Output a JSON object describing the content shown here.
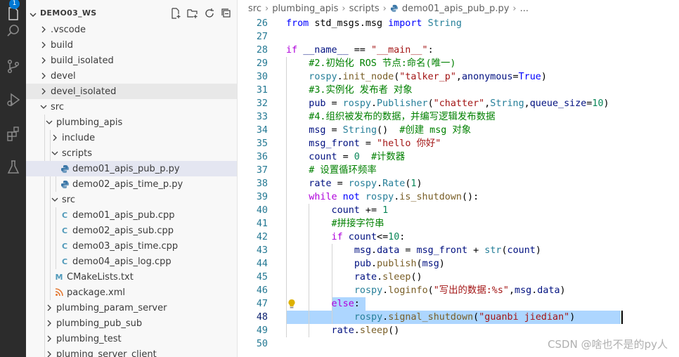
{
  "activity_bar": {
    "badge_count": "1",
    "icons": [
      "explorer-icon",
      "search-icon",
      "source-control-icon",
      "run-debug-icon",
      "extensions-icon",
      "testing-icon"
    ]
  },
  "sidebar": {
    "workspace_title": "DEMO03_WS",
    "tree": [
      {
        "label": ".vscode",
        "kind": "folder",
        "open": false,
        "depth": 0
      },
      {
        "label": "build",
        "kind": "folder",
        "open": false,
        "depth": 0
      },
      {
        "label": "build_isolated",
        "kind": "folder",
        "open": false,
        "depth": 0
      },
      {
        "label": "devel",
        "kind": "folder",
        "open": false,
        "depth": 0
      },
      {
        "label": "devel_isolated",
        "kind": "folder",
        "open": false,
        "depth": 0,
        "state": "hover"
      },
      {
        "label": "src",
        "kind": "folder",
        "open": true,
        "depth": 0
      },
      {
        "label": "plumbing_apis",
        "kind": "folder",
        "open": true,
        "depth": 1
      },
      {
        "label": "include",
        "kind": "folder",
        "open": false,
        "depth": 2
      },
      {
        "label": "scripts",
        "kind": "folder",
        "open": true,
        "depth": 2
      },
      {
        "label": "demo01_apis_pub_p.py",
        "kind": "python",
        "depth": 3,
        "state": "selected"
      },
      {
        "label": "demo02_apis_time_p.py",
        "kind": "python",
        "depth": 3
      },
      {
        "label": "src",
        "kind": "folder",
        "open": true,
        "depth": 2
      },
      {
        "label": "demo01_apis_pub.cpp",
        "kind": "cpp",
        "depth": 3
      },
      {
        "label": "demo02_apis_sub.cpp",
        "kind": "cpp",
        "depth": 3
      },
      {
        "label": "demo03_apis_time.cpp",
        "kind": "cpp",
        "depth": 3
      },
      {
        "label": "demo04_apis_log.cpp",
        "kind": "cpp",
        "depth": 3
      },
      {
        "label": "CMakeLists.txt",
        "kind": "cmake",
        "depth": 2
      },
      {
        "label": "package.xml",
        "kind": "xml",
        "depth": 2
      },
      {
        "label": "plumbing_param_server",
        "kind": "folder",
        "open": false,
        "depth": 1
      },
      {
        "label": "plumbing_pub_sub",
        "kind": "folder",
        "open": false,
        "depth": 1
      },
      {
        "label": "plumbing_test",
        "kind": "folder",
        "open": false,
        "depth": 1
      },
      {
        "label": "pluming_server_client",
        "kind": "folder",
        "open": false,
        "depth": 1
      }
    ]
  },
  "breadcrumb": [
    "src",
    "plumbing_apis",
    "scripts",
    "demo01_apis_pub_p.py",
    "..."
  ],
  "editor": {
    "active_line": 48,
    "lines": [
      {
        "n": "26",
        "indent": 0,
        "tokens": [
          [
            "kw",
            "from "
          ],
          [
            "plain",
            "std_msgs.msg "
          ],
          [
            "kw",
            "import "
          ],
          [
            "cls",
            "String"
          ]
        ]
      },
      {
        "n": "27",
        "indent": 0,
        "tokens": []
      },
      {
        "n": "28",
        "indent": 0,
        "tokens": [
          [
            "ctl",
            "if "
          ],
          [
            "var",
            "__name__"
          ],
          [
            "plain",
            " == "
          ],
          [
            "str",
            "\"__main__\""
          ],
          [
            "plain",
            ":"
          ]
        ]
      },
      {
        "n": "29",
        "indent": 1,
        "tokens": [
          [
            "cmt",
            "#2.初始化 ROS 节点:命名(唯一)"
          ]
        ]
      },
      {
        "n": "30",
        "indent": 1,
        "tokens": [
          [
            "cls",
            "rospy"
          ],
          [
            "plain",
            "."
          ],
          [
            "fn",
            "init_node"
          ],
          [
            "plain",
            "("
          ],
          [
            "str",
            "\"talker_p\""
          ],
          [
            "plain",
            ","
          ],
          [
            "var",
            "anonymous"
          ],
          [
            "plain",
            "="
          ],
          [
            "kw",
            "True"
          ],
          [
            "plain",
            ")"
          ]
        ]
      },
      {
        "n": "31",
        "indent": 1,
        "tokens": [
          [
            "cmt",
            "#3.实例化 发布者 对象"
          ]
        ]
      },
      {
        "n": "32",
        "indent": 1,
        "tokens": [
          [
            "var",
            "pub"
          ],
          [
            "plain",
            " = "
          ],
          [
            "cls",
            "rospy"
          ],
          [
            "plain",
            "."
          ],
          [
            "cls",
            "Publisher"
          ],
          [
            "plain",
            "("
          ],
          [
            "str",
            "\"chatter\""
          ],
          [
            "plain",
            ","
          ],
          [
            "cls",
            "String"
          ],
          [
            "plain",
            ","
          ],
          [
            "var",
            "queue_size"
          ],
          [
            "plain",
            "="
          ],
          [
            "num",
            "10"
          ],
          [
            "plain",
            ")"
          ]
        ]
      },
      {
        "n": "33",
        "indent": 1,
        "tokens": [
          [
            "cmt",
            "#4.组织被发布的数据，并编写逻辑发布数据"
          ]
        ]
      },
      {
        "n": "34",
        "indent": 1,
        "tokens": [
          [
            "var",
            "msg"
          ],
          [
            "plain",
            " = "
          ],
          [
            "cls",
            "String"
          ],
          [
            "plain",
            "()  "
          ],
          [
            "cmt",
            "#创建 msg 对象"
          ]
        ]
      },
      {
        "n": "35",
        "indent": 1,
        "tokens": [
          [
            "var",
            "msg_front"
          ],
          [
            "plain",
            " = "
          ],
          [
            "str",
            "\"hello 你好\""
          ]
        ]
      },
      {
        "n": "36",
        "indent": 1,
        "tokens": [
          [
            "var",
            "count"
          ],
          [
            "plain",
            " = "
          ],
          [
            "num",
            "0"
          ],
          [
            "plain",
            "  "
          ],
          [
            "cmt",
            "#计数器"
          ]
        ]
      },
      {
        "n": "37",
        "indent": 1,
        "tokens": [
          [
            "cmt",
            "# 设置循环频率"
          ]
        ]
      },
      {
        "n": "38",
        "indent": 1,
        "tokens": [
          [
            "var",
            "rate"
          ],
          [
            "plain",
            " = "
          ],
          [
            "cls",
            "rospy"
          ],
          [
            "plain",
            "."
          ],
          [
            "cls",
            "Rate"
          ],
          [
            "plain",
            "("
          ],
          [
            "num",
            "1"
          ],
          [
            "plain",
            ")"
          ]
        ]
      },
      {
        "n": "39",
        "indent": 1,
        "tokens": [
          [
            "ctl",
            "while "
          ],
          [
            "kw",
            "not "
          ],
          [
            "cls",
            "rospy"
          ],
          [
            "plain",
            "."
          ],
          [
            "fn",
            "is_shutdown"
          ],
          [
            "plain",
            "():"
          ]
        ]
      },
      {
        "n": "40",
        "indent": 2,
        "tokens": [
          [
            "var",
            "count"
          ],
          [
            "plain",
            " += "
          ],
          [
            "num",
            "1"
          ]
        ]
      },
      {
        "n": "41",
        "indent": 2,
        "tokens": [
          [
            "cmt",
            "#拼接字符串"
          ]
        ]
      },
      {
        "n": "42",
        "indent": 2,
        "tokens": [
          [
            "ctl",
            "if "
          ],
          [
            "var",
            "count"
          ],
          [
            "plain",
            "<="
          ],
          [
            "num",
            "10"
          ],
          [
            "plain",
            ":"
          ]
        ]
      },
      {
        "n": "43",
        "indent": 3,
        "tokens": [
          [
            "var",
            "msg"
          ],
          [
            "plain",
            "."
          ],
          [
            "var",
            "data"
          ],
          [
            "plain",
            " = "
          ],
          [
            "var",
            "msg_front"
          ],
          [
            "plain",
            " + "
          ],
          [
            "cls",
            "str"
          ],
          [
            "plain",
            "("
          ],
          [
            "var",
            "count"
          ],
          [
            "plain",
            ")"
          ]
        ]
      },
      {
        "n": "44",
        "indent": 3,
        "tokens": [
          [
            "var",
            "pub"
          ],
          [
            "plain",
            "."
          ],
          [
            "fn",
            "publish"
          ],
          [
            "plain",
            "("
          ],
          [
            "var",
            "msg"
          ],
          [
            "plain",
            ")"
          ]
        ]
      },
      {
        "n": "45",
        "indent": 3,
        "tokens": [
          [
            "var",
            "rate"
          ],
          [
            "plain",
            "."
          ],
          [
            "fn",
            "sleep"
          ],
          [
            "plain",
            "()"
          ]
        ]
      },
      {
        "n": "46",
        "indent": 3,
        "tokens": [
          [
            "cls",
            "rospy"
          ],
          [
            "plain",
            "."
          ],
          [
            "fn",
            "loginfo"
          ],
          [
            "plain",
            "("
          ],
          [
            "str",
            "\"写出的数据:%s\""
          ],
          [
            "plain",
            ","
          ],
          [
            "var",
            "msg"
          ],
          [
            "plain",
            "."
          ],
          [
            "var",
            "data"
          ],
          [
            "plain",
            ")"
          ]
        ]
      },
      {
        "n": "47",
        "indent": 2,
        "tokens": [
          [
            "ctl",
            "else"
          ],
          [
            "plain",
            ":"
          ]
        ]
      },
      {
        "n": "48",
        "indent": 3,
        "tokens": [
          [
            "cls",
            "rospy"
          ],
          [
            "plain",
            "."
          ],
          [
            "fn",
            "signal_shutdown"
          ],
          [
            "plain",
            "("
          ],
          [
            "str",
            "\"guanbi jiedian\""
          ],
          [
            "plain",
            ")"
          ]
        ]
      },
      {
        "n": "49",
        "indent": 2,
        "tokens": [
          [
            "var",
            "rate"
          ],
          [
            "plain",
            "."
          ],
          [
            "fn",
            "sleep"
          ],
          [
            "plain",
            "()"
          ]
        ]
      },
      {
        "n": "50",
        "indent": 0,
        "tokens": []
      }
    ]
  },
  "watermark": "CSDN @啥也不是的py人",
  "colors": {
    "accent": "#0078d4",
    "selection": "#add6ff",
    "activity_bg": "#2c2c2c"
  }
}
